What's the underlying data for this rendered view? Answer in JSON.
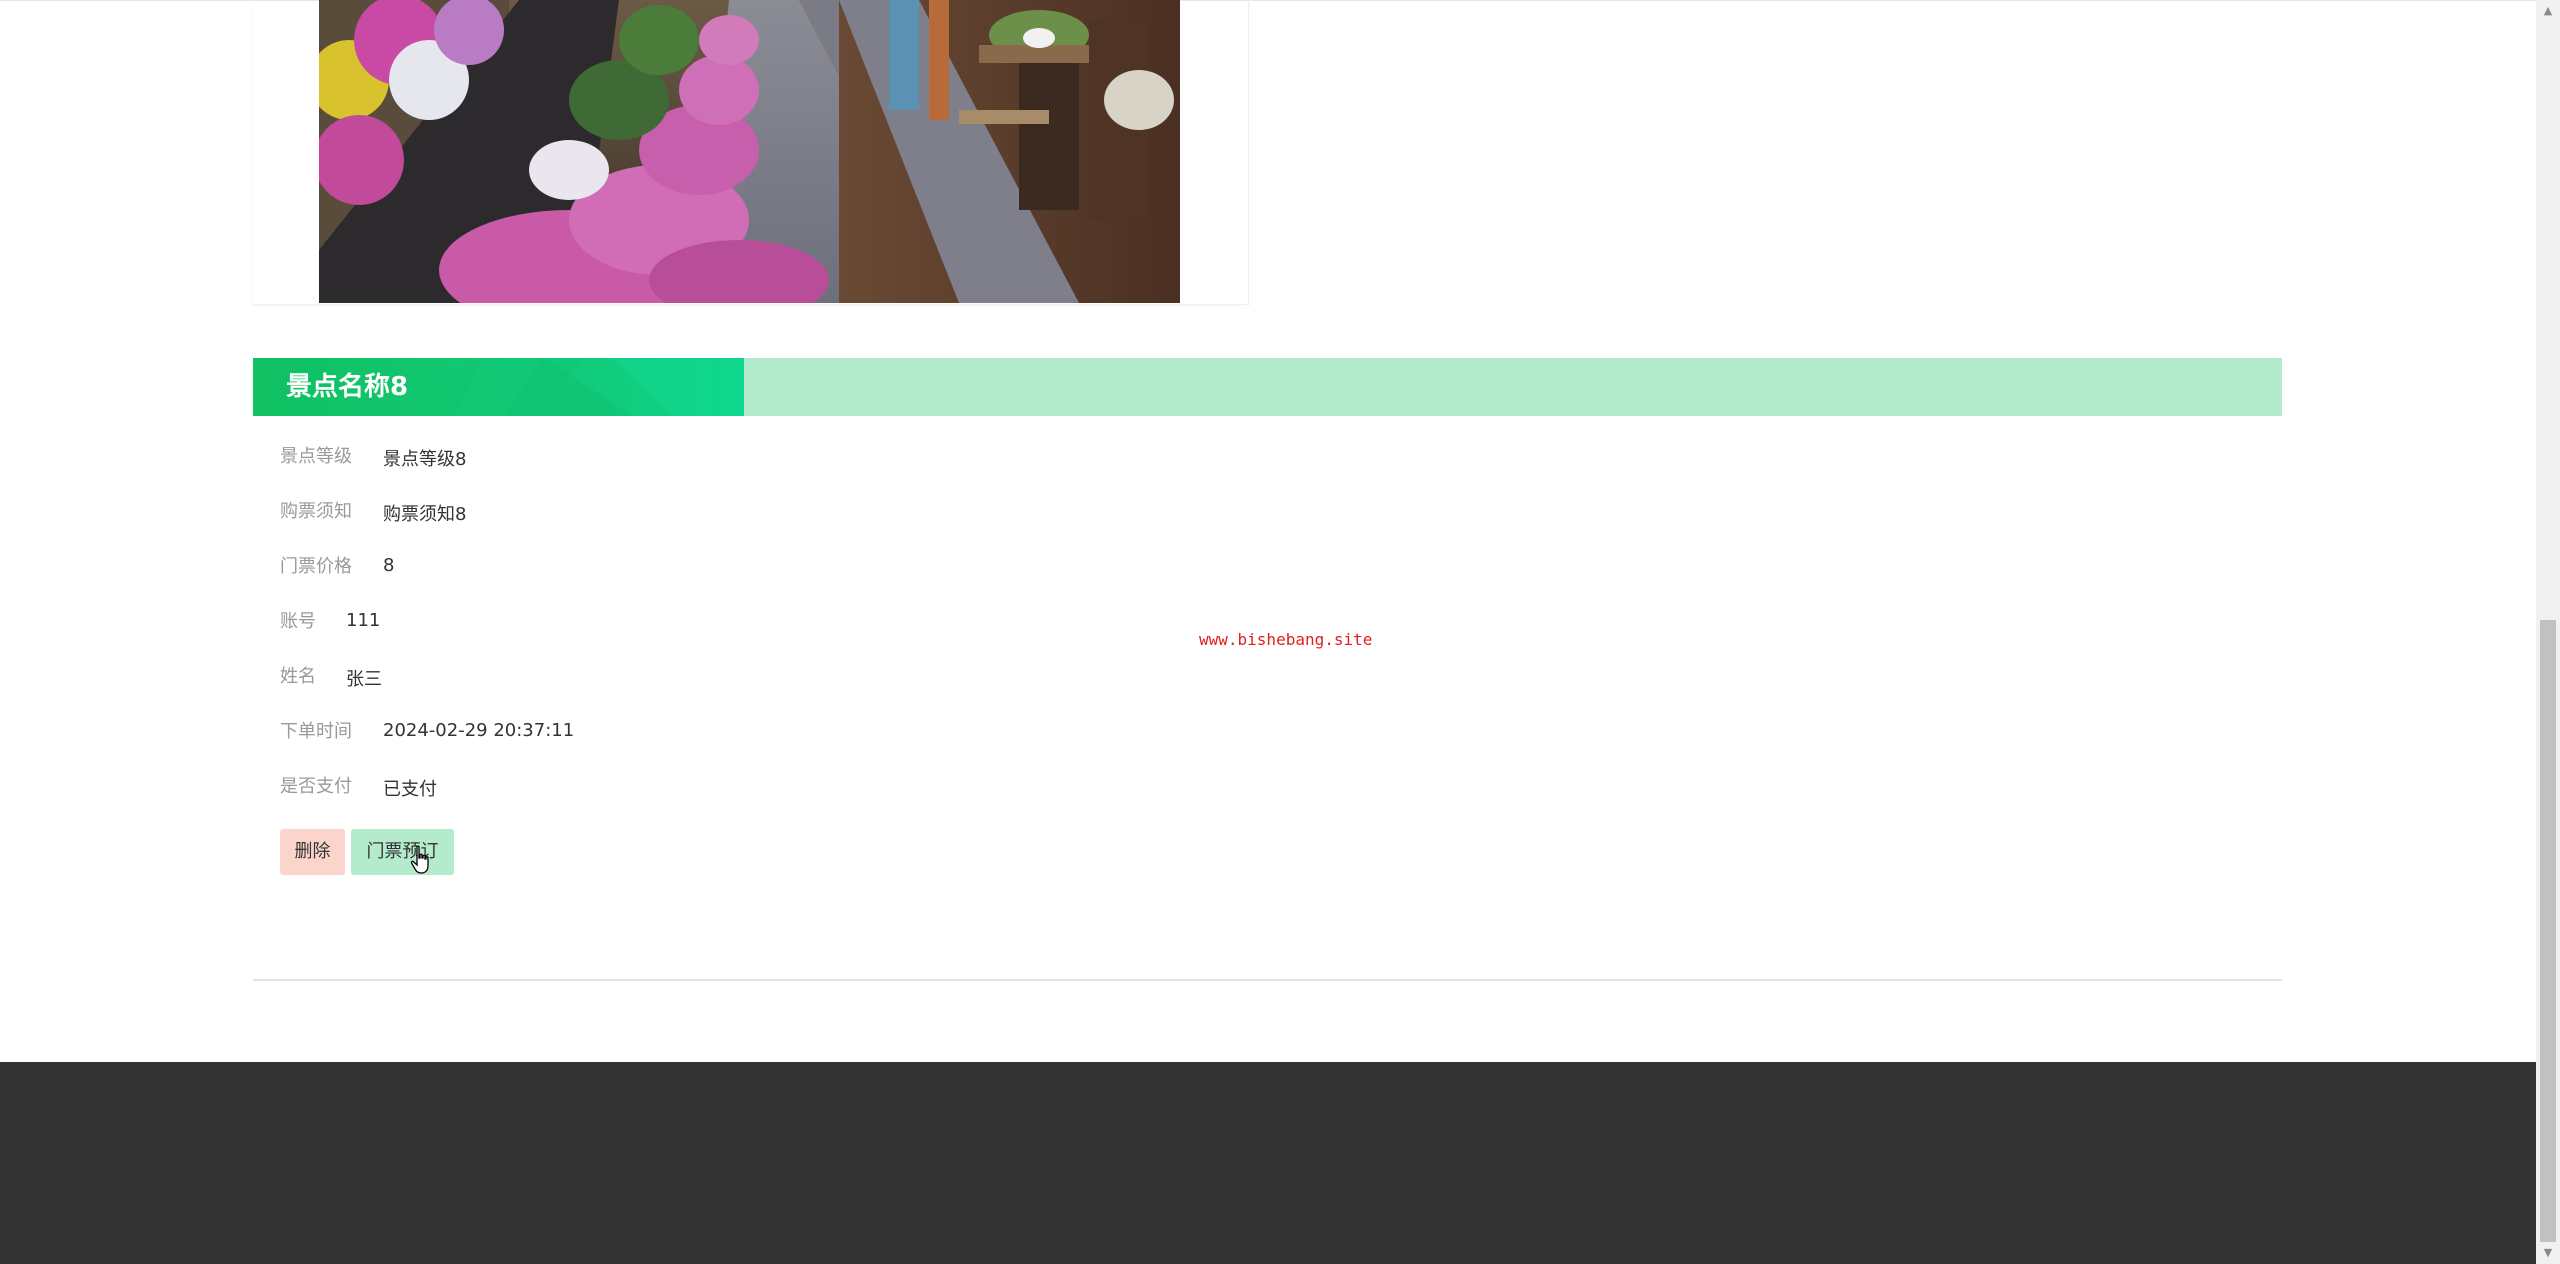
{
  "spot": {
    "title": "景点名称8",
    "image_alt": "lane-with-flowers-photo"
  },
  "details": {
    "level_label": "景点等级",
    "level_value": "景点等级8",
    "notice_label": "购票须知",
    "notice_value": "购票须知8",
    "price_label": "门票价格",
    "price_value": "8",
    "account_label": "账号",
    "account_value": "111",
    "name_label": "姓名",
    "name_value": "张三",
    "order_time_label": "下单时间",
    "order_time_value": "2024-02-29 20:37:11",
    "paid_label": "是否支付",
    "paid_value": "已支付"
  },
  "actions": {
    "delete_label": "删除",
    "reorder_label": "门票预订"
  },
  "watermark": "www.bishebang.site",
  "colors": {
    "accent_green": "#12c976",
    "light_green": "#b3ebcc",
    "light_red": "#fbd5cb",
    "footer": "#333333",
    "watermark_red": "#e02020"
  }
}
